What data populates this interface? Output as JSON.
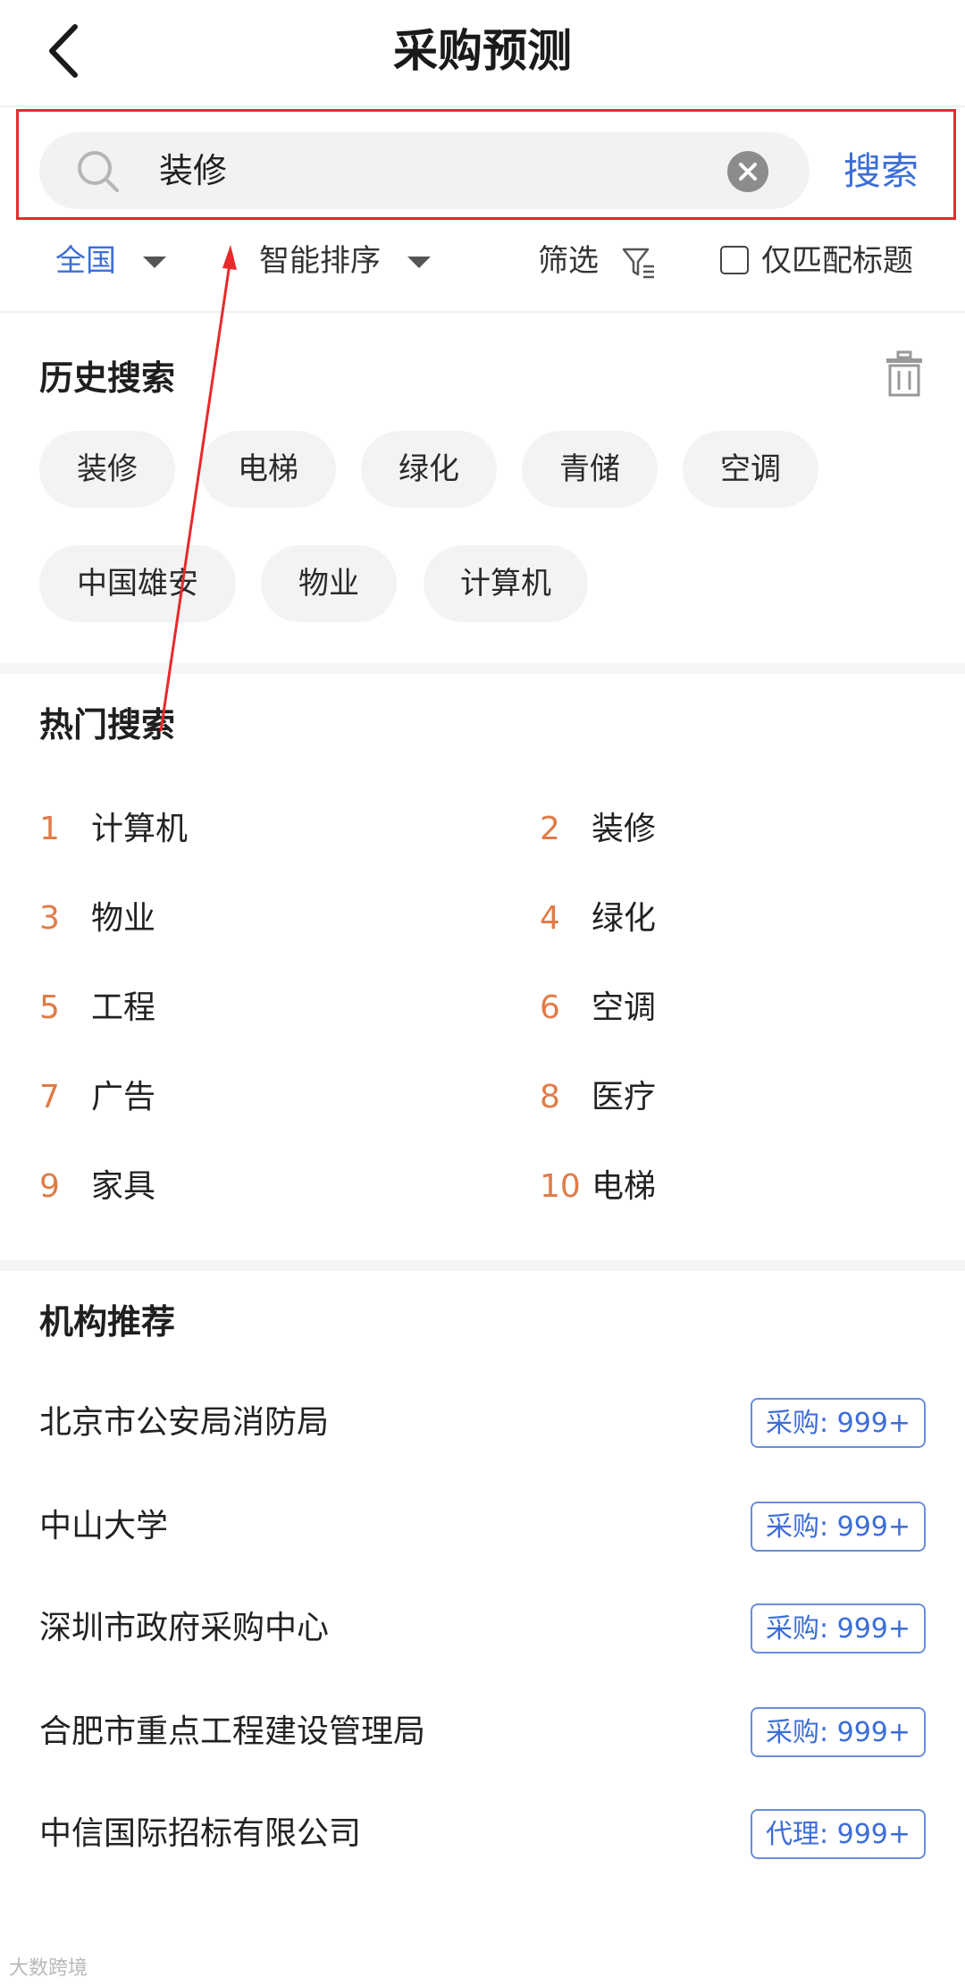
{
  "header": {
    "title": "采购预测"
  },
  "search": {
    "value": "装修",
    "submit_label": "搜索"
  },
  "filters": {
    "region": "全国",
    "sort": "智能排序",
    "filter": "筛选",
    "match_title": "仅匹配标题",
    "match_title_checked": false
  },
  "history": {
    "title": "历史搜索",
    "items": [
      "装修",
      "电梯",
      "绿化",
      "青储",
      "空调",
      "中国雄安",
      "物业",
      "计算机"
    ]
  },
  "hot": {
    "title": "热门搜索",
    "items": [
      {
        "rank": "1",
        "word": "计算机"
      },
      {
        "rank": "2",
        "word": "装修"
      },
      {
        "rank": "3",
        "word": "物业"
      },
      {
        "rank": "4",
        "word": "绿化"
      },
      {
        "rank": "5",
        "word": "工程"
      },
      {
        "rank": "6",
        "word": "空调"
      },
      {
        "rank": "7",
        "word": "广告"
      },
      {
        "rank": "8",
        "word": "医疗"
      },
      {
        "rank": "9",
        "word": "家具"
      },
      {
        "rank": "10",
        "word": "电梯"
      }
    ]
  },
  "orgs": {
    "title": "机构推荐",
    "items": [
      {
        "name": "北京市公安局消防局",
        "tag": "采购: 999+"
      },
      {
        "name": "中山大学",
        "tag": "采购: 999+"
      },
      {
        "name": "深圳市政府采购中心",
        "tag": "采购: 999+"
      },
      {
        "name": "合肥市重点工程建设管理局",
        "tag": "采购: 999+"
      },
      {
        "name": "中信国际招标有限公司",
        "tag": "代理: 999+"
      }
    ]
  },
  "watermark": "大数跨境",
  "colors": {
    "accent": "#3c6ed8",
    "rank": "#e07b48",
    "annotation": "#e8292c"
  }
}
